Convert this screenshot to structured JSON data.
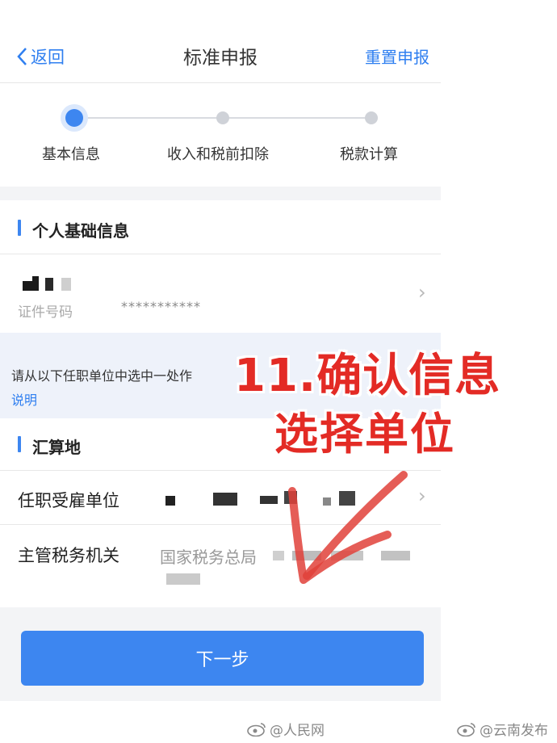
{
  "header": {
    "back_label": "返回",
    "title": "标准申报",
    "reset_label": "重置申报"
  },
  "steps": [
    {
      "label": "基本信息",
      "active": true
    },
    {
      "label": "收入和税前扣除",
      "active": false
    },
    {
      "label": "税款计算",
      "active": false
    }
  ],
  "personal": {
    "section_title": "个人基础信息",
    "id_label": "证件号码",
    "id_value": "***********"
  },
  "notice": {
    "text": "请从以下任职单位中选中一处作",
    "link": "说明"
  },
  "settlement": {
    "section_title": "汇算地",
    "employer_label": "任职受雇单位",
    "tax_office_label": "主管税务机关",
    "tax_office_value": "国家税务总局"
  },
  "next_button": "下一步",
  "annotation": {
    "line1": "11.确认信息",
    "line2": "选择单位"
  },
  "watermarks": {
    "left": "@人民网",
    "right": "@云南发布"
  },
  "colors": {
    "accent": "#3d86f0",
    "annotation": "#e32b25"
  },
  "icons": [
    "chevron-left-icon",
    "chevron-right-icon",
    "weibo-icon",
    "hand-drawn-arrow-icon"
  ]
}
